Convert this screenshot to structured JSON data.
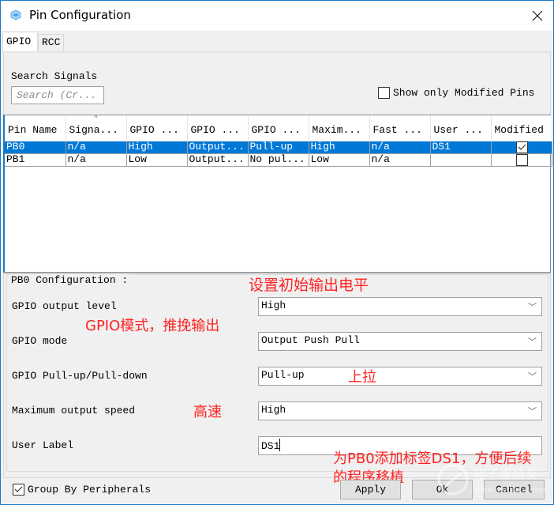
{
  "window": {
    "title": "Pin Configuration",
    "close_icon": "close-icon",
    "app_icon": "cube-icon"
  },
  "tabs": [
    {
      "label": "GPIO",
      "active": true
    },
    {
      "label": "RCC",
      "active": false
    }
  ],
  "search": {
    "label": "Search Signals",
    "placeholder": "Search (Cr...",
    "value": ""
  },
  "show_modified": {
    "label": "Show only Modified Pins",
    "checked": false
  },
  "table": {
    "columns": [
      "Pin Name",
      "Signa...",
      "GPIO ...",
      "GPIO ...",
      "GPIO ...",
      "Maxim...",
      "Fast ...",
      "User ...",
      "Modified"
    ],
    "sorted_column": 1,
    "rows": [
      {
        "cells": [
          "PB0",
          "n/a",
          "High",
          "Output...",
          "Pull-up",
          "High",
          "n/a",
          "DS1"
        ],
        "modified": true,
        "selected": true
      },
      {
        "cells": [
          "PB1",
          "n/a",
          "Low",
          "Output...",
          "No pul...",
          "Low",
          "n/a",
          ""
        ],
        "modified": false,
        "selected": false
      }
    ]
  },
  "config": {
    "group_title": "PB0 Configuration :",
    "fields": [
      {
        "label": "GPIO output level",
        "type": "select",
        "value": "High"
      },
      {
        "label": "GPIO mode",
        "type": "select",
        "value": "Output Push Pull"
      },
      {
        "label": "GPIO Pull-up/Pull-down",
        "type": "select",
        "value": "Pull-up"
      },
      {
        "label": "Maximum output speed",
        "type": "select",
        "value": "High"
      },
      {
        "label": "User Label",
        "type": "text",
        "value": "DS1"
      }
    ]
  },
  "annotations": {
    "output_level": "设置初始输出电平",
    "mode": "GPIO模式，推挽输出",
    "pull": "上拉",
    "speed": "高速",
    "label_line1": "为PB0添加标签DS1，方便后续",
    "label_line2": "的程序移植"
  },
  "footer": {
    "group_by_label": "Group By Peripherals",
    "group_by_checked": true,
    "apply_label": "Apply",
    "ok_label": "Ok",
    "cancel_label": "Cancel"
  },
  "watermark": {
    "text": "电子发烧友",
    "url_text": "www.elecfans.com"
  },
  "colors": {
    "selection": "#0078d7",
    "window_border": "#1979ca",
    "annotation": "#ff2222"
  }
}
